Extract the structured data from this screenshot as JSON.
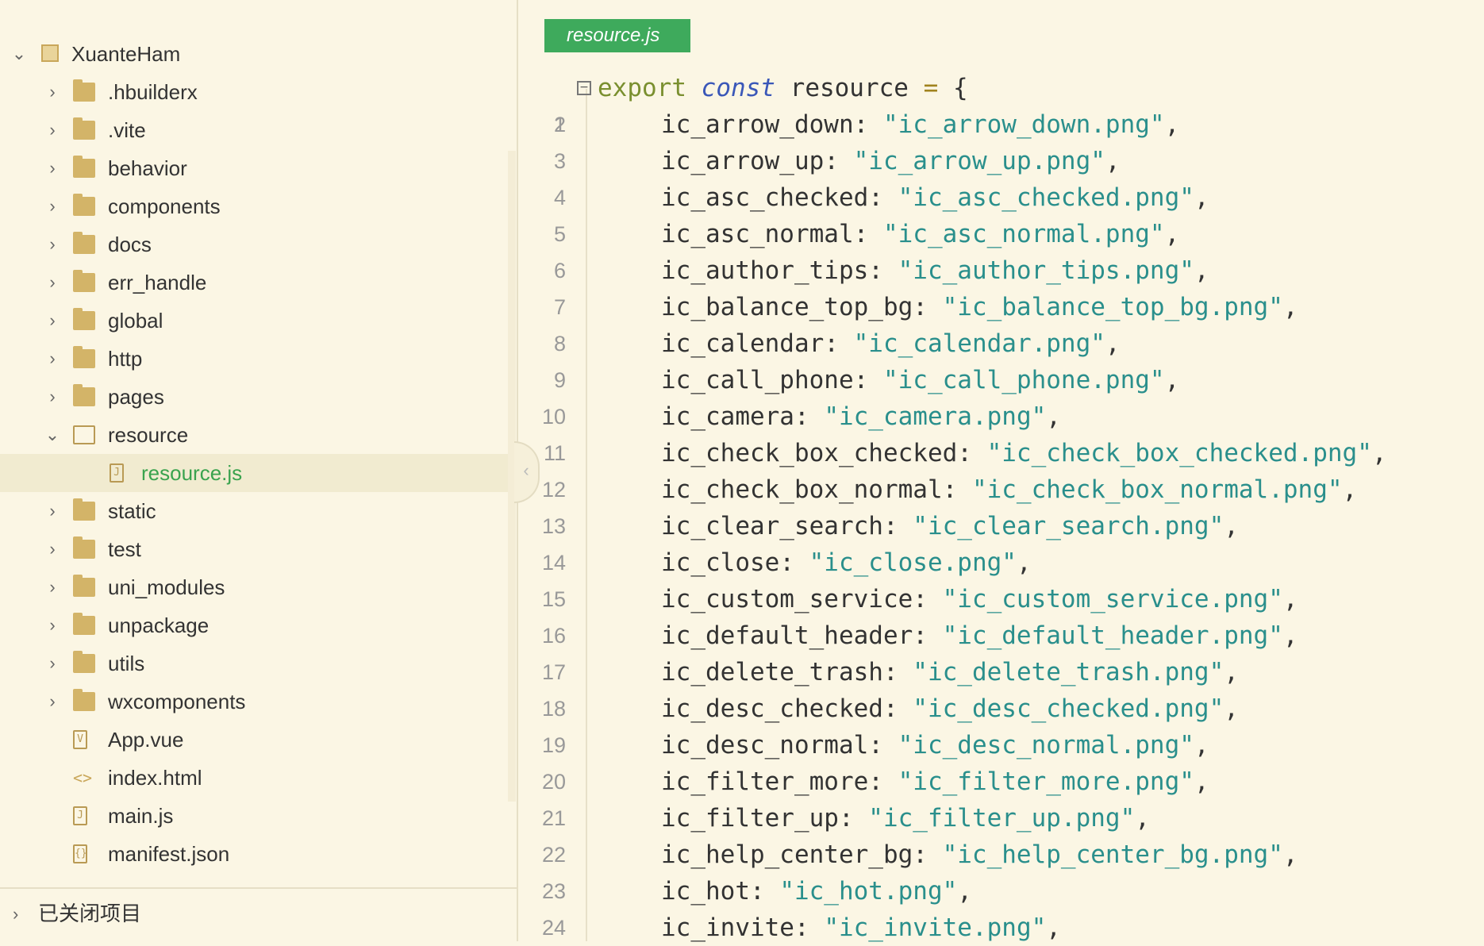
{
  "sidebar": {
    "project": "XuanteHam",
    "items": [
      {
        "label": ".hbuilderx",
        "type": "folder",
        "expanded": false,
        "depth": 1
      },
      {
        "label": ".vite",
        "type": "folder",
        "expanded": false,
        "depth": 1
      },
      {
        "label": "behavior",
        "type": "folder",
        "expanded": false,
        "depth": 1
      },
      {
        "label": "components",
        "type": "folder",
        "expanded": false,
        "depth": 1
      },
      {
        "label": "docs",
        "type": "folder",
        "expanded": false,
        "depth": 1
      },
      {
        "label": "err_handle",
        "type": "folder",
        "expanded": false,
        "depth": 1
      },
      {
        "label": "global",
        "type": "folder",
        "expanded": false,
        "depth": 1
      },
      {
        "label": "http",
        "type": "folder",
        "expanded": false,
        "depth": 1
      },
      {
        "label": "pages",
        "type": "folder",
        "expanded": false,
        "depth": 1
      },
      {
        "label": "resource",
        "type": "folder",
        "expanded": true,
        "depth": 1
      },
      {
        "label": "resource.js",
        "type": "js",
        "selected": true,
        "depth": 2
      },
      {
        "label": "static",
        "type": "folder",
        "expanded": false,
        "depth": 1
      },
      {
        "label": "test",
        "type": "folder",
        "expanded": false,
        "depth": 1
      },
      {
        "label": "uni_modules",
        "type": "folder",
        "expanded": false,
        "depth": 1
      },
      {
        "label": "unpackage",
        "type": "folder",
        "expanded": false,
        "depth": 1
      },
      {
        "label": "utils",
        "type": "folder",
        "expanded": false,
        "depth": 1
      },
      {
        "label": "wxcomponents",
        "type": "folder",
        "expanded": false,
        "depth": 1
      },
      {
        "label": "App.vue",
        "type": "vue",
        "depth": 1
      },
      {
        "label": "index.html",
        "type": "html",
        "depth": 1
      },
      {
        "label": "main.js",
        "type": "js",
        "depth": 1
      },
      {
        "label": "manifest.json",
        "type": "json",
        "depth": 1
      }
    ],
    "closed_projects_label": "已关闭项目"
  },
  "editor": {
    "tab_label": "resource.js",
    "first_line": {
      "kw1": "export",
      "kw2": "const",
      "name": "resource",
      "op": "=",
      "brace": "{"
    },
    "entries": [
      {
        "key": "ic_arrow_down",
        "value": "\"ic_arrow_down.png\""
      },
      {
        "key": "ic_arrow_up",
        "value": "\"ic_arrow_up.png\""
      },
      {
        "key": "ic_asc_checked",
        "value": "\"ic_asc_checked.png\""
      },
      {
        "key": "ic_asc_normal",
        "value": "\"ic_asc_normal.png\""
      },
      {
        "key": "ic_author_tips",
        "value": "\"ic_author_tips.png\""
      },
      {
        "key": "ic_balance_top_bg",
        "value": "\"ic_balance_top_bg.png\""
      },
      {
        "key": "ic_calendar",
        "value": "\"ic_calendar.png\""
      },
      {
        "key": "ic_call_phone",
        "value": "\"ic_call_phone.png\""
      },
      {
        "key": "ic_camera",
        "value": "\"ic_camera.png\""
      },
      {
        "key": "ic_check_box_checked",
        "value": "\"ic_check_box_checked.png\""
      },
      {
        "key": "ic_check_box_normal",
        "value": "\"ic_check_box_normal.png\""
      },
      {
        "key": "ic_clear_search",
        "value": "\"ic_clear_search.png\""
      },
      {
        "key": "ic_close",
        "value": "\"ic_close.png\""
      },
      {
        "key": "ic_custom_service",
        "value": "\"ic_custom_service.png\""
      },
      {
        "key": "ic_default_header",
        "value": "\"ic_default_header.png\""
      },
      {
        "key": "ic_delete_trash",
        "value": "\"ic_delete_trash.png\""
      },
      {
        "key": "ic_desc_checked",
        "value": "\"ic_desc_checked.png\""
      },
      {
        "key": "ic_desc_normal",
        "value": "\"ic_desc_normal.png\""
      },
      {
        "key": "ic_filter_more",
        "value": "\"ic_filter_more.png\""
      },
      {
        "key": "ic_filter_up",
        "value": "\"ic_filter_up.png\""
      },
      {
        "key": "ic_help_center_bg",
        "value": "\"ic_help_center_bg.png\""
      },
      {
        "key": "ic_hot",
        "value": "\"ic_hot.png\""
      },
      {
        "key": "ic_invite",
        "value": "\"ic_invite.png\""
      }
    ]
  },
  "colors": {
    "background": "#fbf6e4",
    "tab_green": "#3eaa5c",
    "selected_text": "#3aa34e",
    "string": "#2a8f8c",
    "keyword": "#7a8f2f",
    "keyword_italic": "#3a57b8"
  }
}
